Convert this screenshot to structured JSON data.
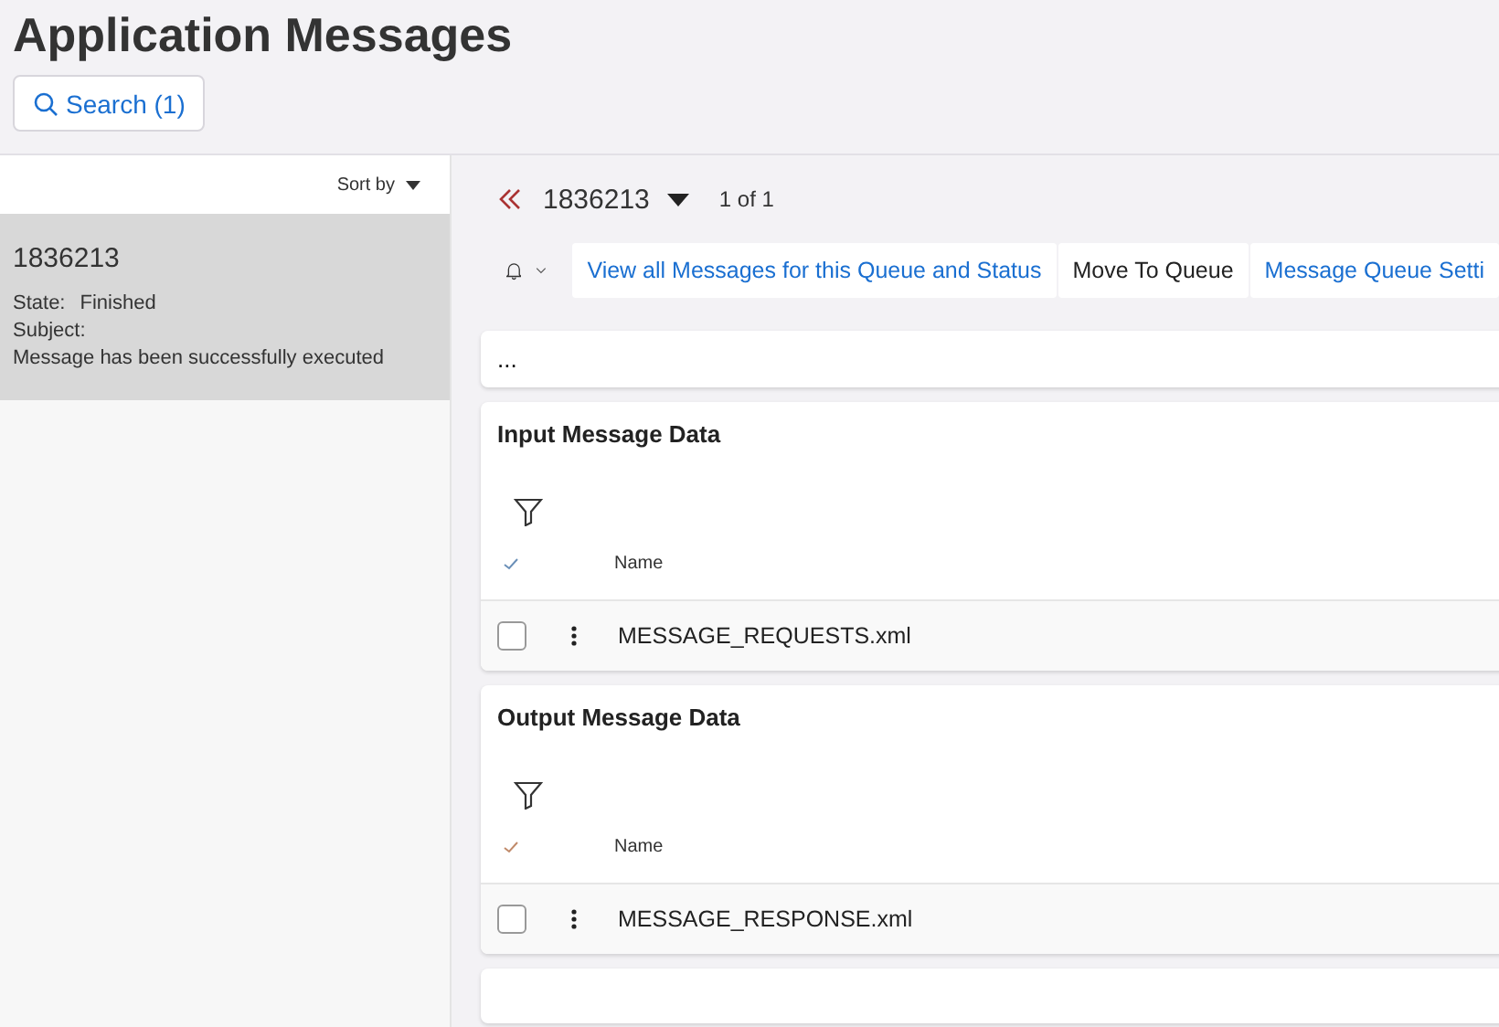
{
  "page": {
    "title": "Application Messages"
  },
  "search_button": {
    "label": "Search (1)"
  },
  "sidebar": {
    "sort_label": "Sort by",
    "items": [
      {
        "id": "1836213",
        "state_label": "State:",
        "state": "Finished",
        "subject_label": "Subject:",
        "subject": "Message has been successfully executed",
        "selected": true
      }
    ]
  },
  "record_nav": {
    "record": "1836213",
    "count": "1 of 1"
  },
  "toolbar": {
    "buttons": [
      {
        "label": "View all Messages for this Queue and Status",
        "kind": "link"
      },
      {
        "label": "Move To Queue",
        "kind": "plain"
      },
      {
        "label": "Message Queue Setti",
        "kind": "link"
      }
    ]
  },
  "summary": {
    "text": "..."
  },
  "sections": [
    {
      "title": "Input Message Data",
      "column": "Name",
      "rows": [
        {
          "name": "MESSAGE_REQUESTS.xml",
          "checked": false
        }
      ]
    },
    {
      "title": "Output Message Data",
      "column": "Name",
      "rows": [
        {
          "name": "MESSAGE_RESPONSE.xml",
          "checked": false
        }
      ]
    }
  ]
}
